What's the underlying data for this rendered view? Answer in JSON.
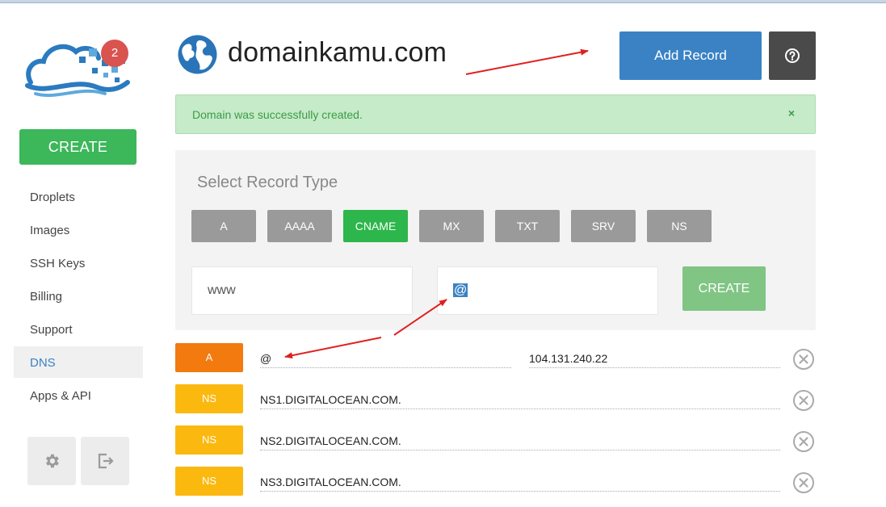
{
  "sidebar": {
    "notification_count": "2",
    "create_label": "CREATE",
    "items": [
      {
        "label": "Droplets"
      },
      {
        "label": "Images"
      },
      {
        "label": "SSH Keys"
      },
      {
        "label": "Billing"
      },
      {
        "label": "Support"
      },
      {
        "label": "DNS",
        "active": true
      },
      {
        "label": "Apps & API"
      }
    ]
  },
  "header": {
    "domain": "domainkamu.com",
    "add_record_label": "Add Record"
  },
  "alert": {
    "message": "Domain was successfully created.",
    "close": "×"
  },
  "record_form": {
    "title": "Select Record Type",
    "types": [
      "A",
      "AAAA",
      "CNAME",
      "MX",
      "TXT",
      "SRV",
      "NS"
    ],
    "selected_type": "CNAME",
    "hostname_value": "www",
    "target_value": "@",
    "create_label": "CREATE"
  },
  "records": [
    {
      "type": "A",
      "name": "@",
      "value": "104.131.240.22"
    },
    {
      "type": "NS",
      "value": "NS1.DIGITALOCEAN.COM."
    },
    {
      "type": "NS",
      "value": "NS2.DIGITALOCEAN.COM."
    },
    {
      "type": "NS",
      "value": "NS3.DIGITALOCEAN.COM."
    }
  ],
  "colors": {
    "brand_blue": "#3a82c4",
    "create_green": "#3cb75a",
    "type_a": "#f27a0f",
    "type_ns": "#fbb80f",
    "annotation_red": "#e02020"
  },
  "icons": {
    "logo": "cloud-logo-icon",
    "domain": "globe-icon",
    "help": "help-icon",
    "settings": "gear-icon",
    "logout": "logout-icon",
    "delete": "close-circle-icon"
  }
}
